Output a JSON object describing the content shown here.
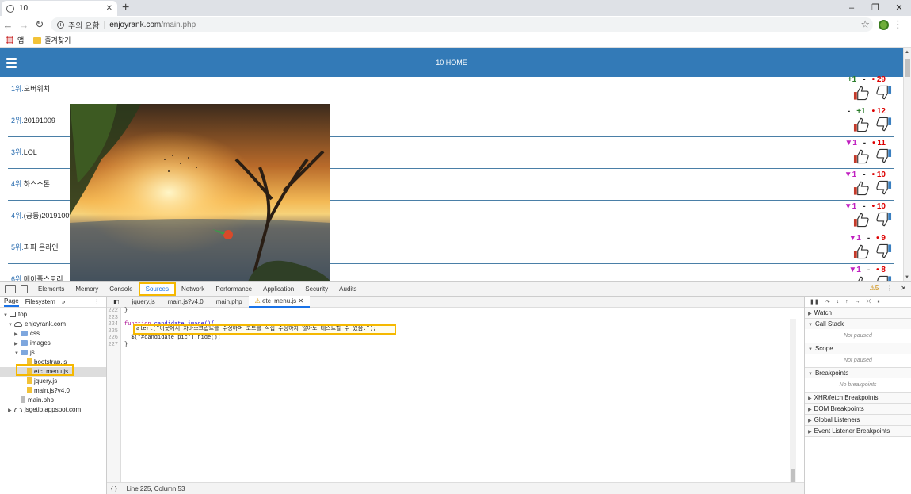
{
  "browser": {
    "tab_title": "10",
    "tab_close": "✕",
    "new_tab": "+",
    "security_warning": "주의 요함",
    "url_host": "enjoyrank.com",
    "url_path": "/main.php",
    "bookmark_apps": "앱",
    "bookmark_favorites": "즐겨찾기",
    "win_min": "–",
    "win_restore": "❐",
    "win_close": "✕"
  },
  "site": {
    "title": "10 HOME"
  },
  "rankings": [
    {
      "rank": "1위.",
      "name": "오버워치",
      "delta": "+1",
      "delta_type": "up",
      "mid": "-",
      "score": "29"
    },
    {
      "rank": "2위.",
      "name": "20191009",
      "delta": "-",
      "delta_type": "none",
      "mid": "+1",
      "score": "12"
    },
    {
      "rank": "3위.",
      "name": "LOL",
      "delta": "▼1",
      "delta_type": "down",
      "mid": "-",
      "score": "11"
    },
    {
      "rank": "4위.",
      "name": "하스스톤",
      "delta": "▼1",
      "delta_type": "down",
      "mid": "-",
      "score": "10"
    },
    {
      "rank": "4위.",
      "name": "(공동)20191009",
      "delta": "▼1",
      "delta_type": "down",
      "mid": "-",
      "score": "10"
    },
    {
      "rank": "5위.",
      "name": "피파 온라인",
      "delta": "▼1",
      "delta_type": "down",
      "mid": "-",
      "score": "9"
    },
    {
      "rank": "6위.",
      "name": "메이플스토리",
      "delta": "▼1",
      "delta_type": "down",
      "mid": "-",
      "score": "8"
    }
  ],
  "devtools": {
    "tabs": [
      "Elements",
      "Memory",
      "Console",
      "Sources",
      "Network",
      "Performance",
      "Application",
      "Security",
      "Audits"
    ],
    "active_tab": "Sources",
    "more": "»",
    "warning_count": "⚠5",
    "nav_tabs": [
      "Page",
      "Filesystem"
    ],
    "tree": {
      "top": "top",
      "domain": "enjoyrank.com",
      "css": "css",
      "images": "images",
      "js": "js",
      "bootstrap": "bootstrap.js",
      "etc_menu": "etc_menu.js",
      "jquery": "jquery.js",
      "main_js": "main.js?v4.0",
      "main_php": "main.php",
      "jsgetip": "jsgetip.appspot.com"
    },
    "editor_tabs": [
      "jquery.js",
      "main.js?v4.0",
      "main.php",
      "etc_menu.js"
    ],
    "editor_tab_close": "✕",
    "code_lines": [
      "222",
      "223",
      "224",
      "225",
      "226",
      "227"
    ],
    "code": {
      "l222": "}",
      "l224_kw": "function",
      "l224_rest": " candidate_image(){",
      "l226": "  $(\"#candidate_pic\").hide();",
      "l227": "}"
    },
    "alert_line": "alert(\"이곳에서 자바스크립트를 수정하며 코드를 직접 수정하지 않아도 테스트할 수 있음.\");",
    "status_braces": "{ }",
    "status_position": "Line 225, Column 53",
    "sections": [
      {
        "title": "Watch",
        "body": ""
      },
      {
        "title": "Call Stack",
        "body": "Not paused"
      },
      {
        "title": "Scope",
        "body": "Not paused"
      },
      {
        "title": "Breakpoints",
        "body": "No breakpoints"
      },
      {
        "title": "XHR/fetch Breakpoints",
        "body": ""
      },
      {
        "title": "DOM Breakpoints",
        "body": ""
      },
      {
        "title": "Global Listeners",
        "body": ""
      },
      {
        "title": "Event Listener Breakpoints",
        "body": ""
      }
    ]
  },
  "colors": {
    "header_blue": "#337ab7",
    "highlight": "#f5b800",
    "up": "#2a7d2a",
    "down": "#c020c0",
    "score": "#dd0000"
  }
}
